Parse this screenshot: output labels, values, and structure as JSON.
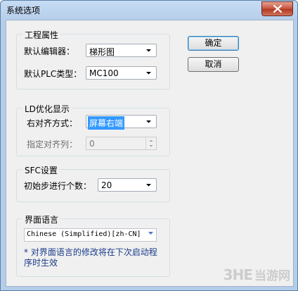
{
  "window": {
    "title": "系统选项"
  },
  "groups": {
    "project": {
      "title": "工程属性",
      "editor_label": "默认编辑器：",
      "editor_value": "梯形图",
      "plc_label": "默认PLC类型：",
      "plc_value": "MC100"
    },
    "ld": {
      "title": "LD优化显示",
      "align_label": "右对齐方式：",
      "align_value": "屏幕右端",
      "column_label": "指定对齐列：",
      "column_value": "0"
    },
    "sfc": {
      "title": "SFC设置",
      "steps_label": "初始步进行个数：",
      "steps_value": "20"
    },
    "language": {
      "title": "界面语言",
      "value": "Chinese (Simplified)[zh-CN]",
      "note": "* 对界面语言的修改将在下次启动程序时生效"
    }
  },
  "buttons": {
    "ok": "确定",
    "cancel": "取消"
  },
  "watermark": {
    "logo": "3HE",
    "text": "当游网"
  },
  "colors": {
    "selection": "#3399ff",
    "note": "#1a3a8a"
  }
}
